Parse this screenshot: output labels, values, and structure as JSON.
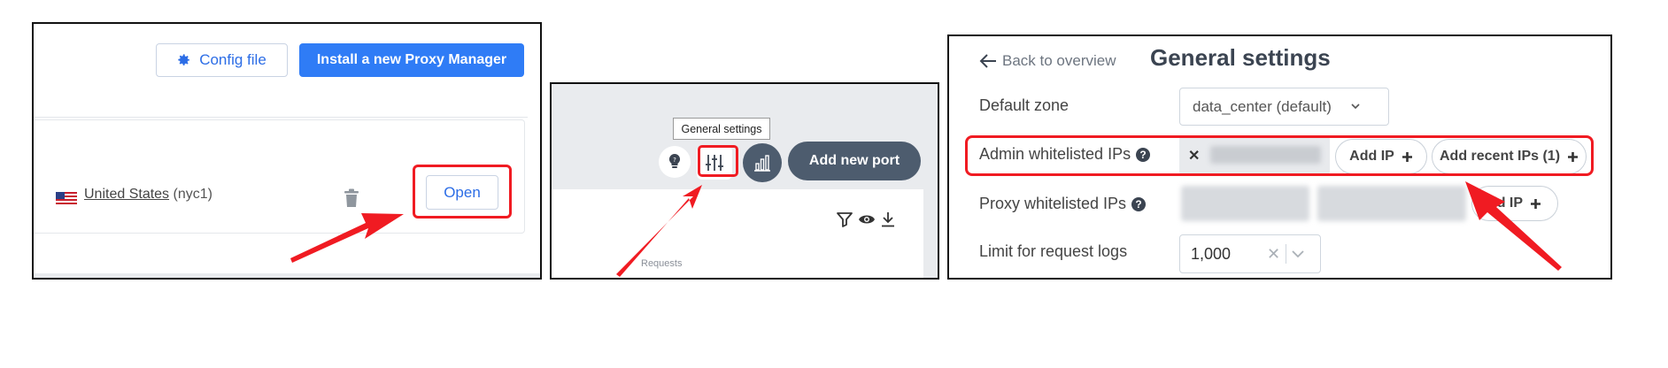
{
  "panel1": {
    "config_label": "Config file",
    "install_label": "Install a new Proxy Manager",
    "location_country": "United States",
    "location_code": "(nyc1)",
    "open_label": "Open"
  },
  "panel2": {
    "tooltip": "General settings",
    "add_port_label": "Add new port",
    "requests_label": "Requests"
  },
  "panel3": {
    "back_label": "Back to overview",
    "title": "General settings",
    "default_zone_label": "Default zone",
    "default_zone_value": "data_center (default)",
    "admin_ips_label": "Admin whitelisted IPs",
    "add_ip_label": "Add IP",
    "add_recent_label": "Add recent IPs (1)",
    "proxy_ips_label": "Proxy whitelisted IPs",
    "proxy_add_ip_label": "dd IP",
    "limit_label": "Limit for request logs",
    "limit_value": "1,000"
  },
  "colors": {
    "primary": "#2f7cf6",
    "highlight": "#f01b22",
    "dark_button": "#4d5c6e"
  }
}
